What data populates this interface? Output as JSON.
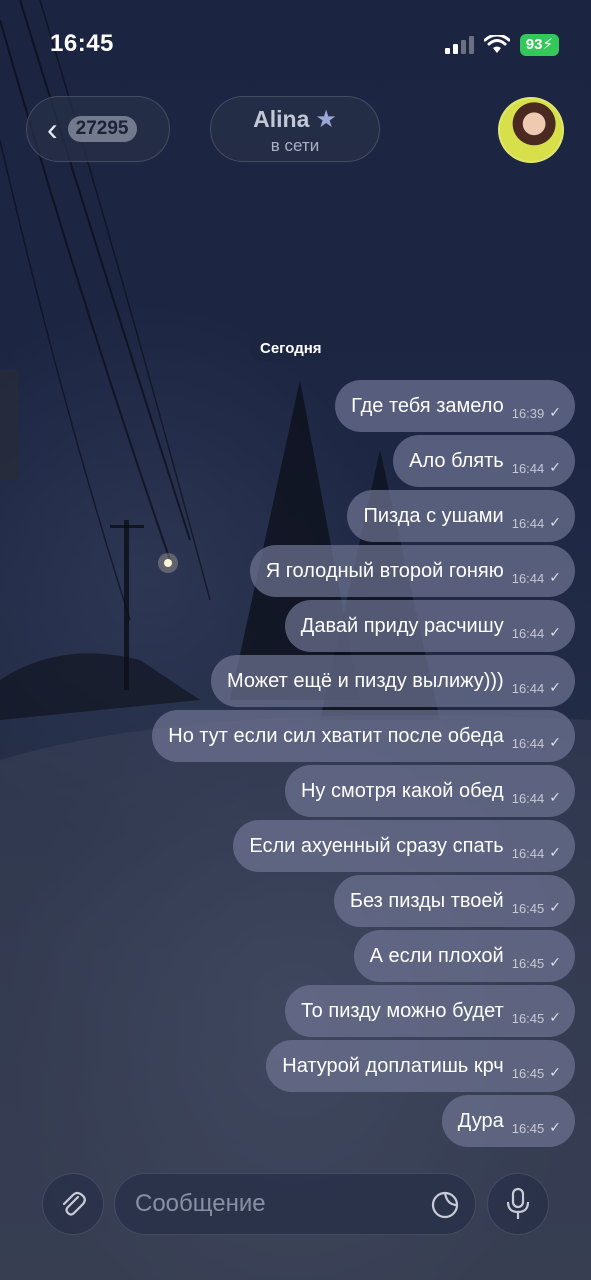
{
  "status_bar": {
    "time": "16:45",
    "battery": "93"
  },
  "header": {
    "back_count": "27295",
    "chat_name": "Alina",
    "chat_status": "в сети"
  },
  "date_label": "Сегодня",
  "messages": [
    {
      "text": "Где тебя замело",
      "time": "16:39"
    },
    {
      "text": "Ало блять",
      "time": "16:44"
    },
    {
      "text": "Пизда с ушами",
      "time": "16:44"
    },
    {
      "text": "Я голодный второй гоняю",
      "time": "16:44"
    },
    {
      "text": "Давай приду расчишу",
      "time": "16:44"
    },
    {
      "text": "Может ещё и пизду вылижу)))",
      "time": "16:44"
    },
    {
      "text": "Но тут если сил хватит после обеда",
      "time": "16:44"
    },
    {
      "text": "Ну смотря какой обед",
      "time": "16:44"
    },
    {
      "text": "Если ахуенный сразу спать",
      "time": "16:44"
    },
    {
      "text": "Без пизды твоей",
      "time": "16:45"
    },
    {
      "text": "А если плохой",
      "time": "16:45"
    },
    {
      "text": "То пизду можно будет",
      "time": "16:45"
    },
    {
      "text": "Натурой доплатишь крч",
      "time": "16:45"
    },
    {
      "text": "Дура",
      "time": "16:45"
    }
  ],
  "input": {
    "placeholder": "Сообщение"
  },
  "icons": {
    "back": "chevron-left-icon",
    "verified": "star-icon",
    "read": "check-icon",
    "attach": "paperclip-icon",
    "sticker": "sticker-icon",
    "voice": "microphone-icon"
  },
  "colors": {
    "battery": "#34c759",
    "bubble": "#6e7391"
  }
}
